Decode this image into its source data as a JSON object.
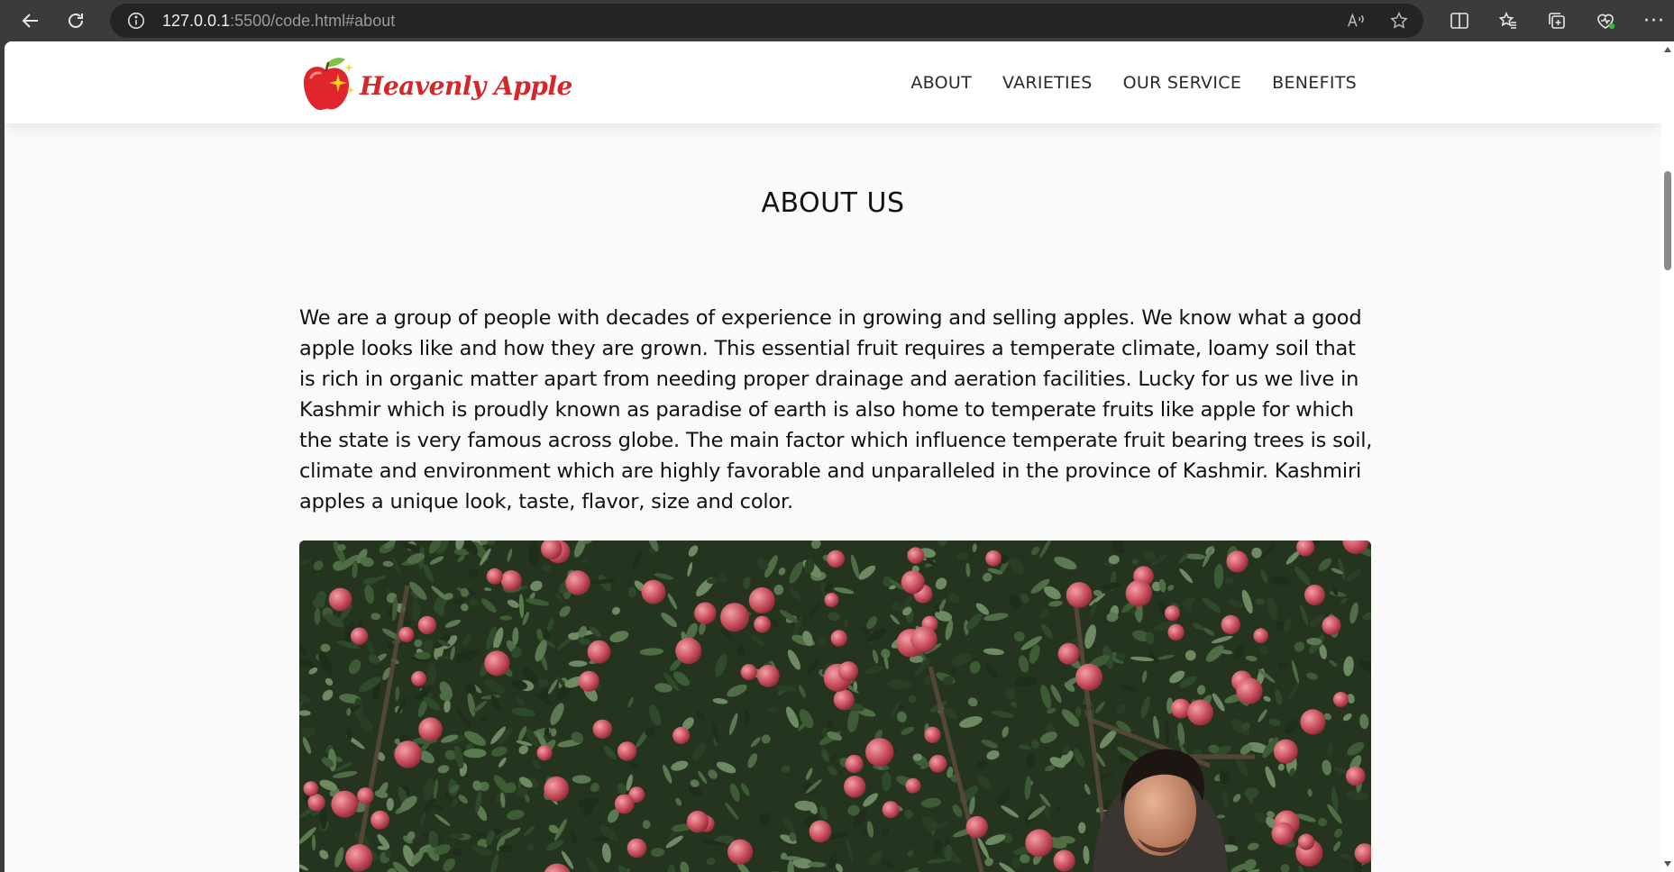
{
  "browser": {
    "url_host": "127.0.0.1",
    "url_rest": ":5500/code.html#about",
    "icons": [
      "back-icon",
      "reload-icon",
      "info-icon",
      "read-aloud-icon",
      "favorite-star-icon",
      "split-screen-icon",
      "favorites-icon",
      "collections-icon",
      "browser-essentials-icon",
      "more-icon"
    ]
  },
  "header": {
    "logo_text": "Heavenly Apple",
    "nav": [
      {
        "label": "ABOUT"
      },
      {
        "label": "VARIETIES"
      },
      {
        "label": "OUR SERVICE"
      },
      {
        "label": "BENEFITS"
      }
    ]
  },
  "about": {
    "title": "ABOUT US",
    "paragraph": "We are a group of people with decades of experience in growing and selling apples. We know what a good apple looks like and how they are grown. This essential fruit requires a temperate climate, loamy soil that is rich in organic matter apart from needing proper drainage and aeration facilities. Lucky for us we live in Kashmir which is proudly known as paradise of earth is also home to temperate fruits like apple for which the state is very famous across globe. The main factor which influence temperate fruit bearing trees is soil, climate and environment which are highly favorable and unparalleled in the province of Kashmir. Kashmiri apples a unique look, taste, flavor, size and color."
  },
  "colors": {
    "brand_red": "#d6262a",
    "page_bg": "#fafafa",
    "chrome_bg": "#3b3b3b"
  }
}
